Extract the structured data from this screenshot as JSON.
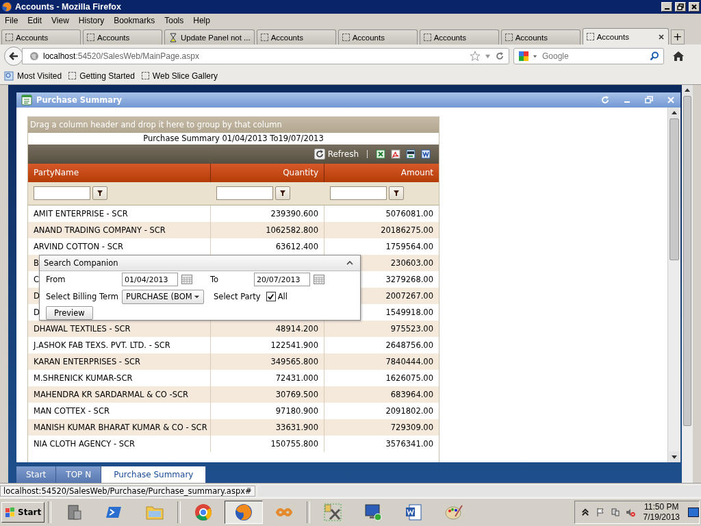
{
  "window": {
    "title": "Accounts - Mozilla Firefox"
  },
  "menu": [
    "File",
    "Edit",
    "View",
    "History",
    "Bookmarks",
    "Tools",
    "Help"
  ],
  "browser_tabs": [
    {
      "label": "Accounts",
      "kind": "page",
      "selected": false
    },
    {
      "label": "Accounts",
      "kind": "page",
      "selected": false
    },
    {
      "label": "Update Panel not ...",
      "kind": "loading",
      "selected": false
    },
    {
      "label": "Accounts",
      "kind": "page",
      "selected": false
    },
    {
      "label": "Accounts",
      "kind": "page",
      "selected": false
    },
    {
      "label": "Accounts",
      "kind": "page",
      "selected": false
    },
    {
      "label": "Accounts",
      "kind": "page",
      "selected": false
    },
    {
      "label": "Accounts",
      "kind": "page",
      "selected": true
    }
  ],
  "new_tab": "+",
  "address_bar": {
    "host": "localhost",
    "path": ":54520/SalesWeb/MainPage.aspx"
  },
  "search": {
    "placeholder": "Google"
  },
  "bookmarks": [
    {
      "label": "Most Visited",
      "kind": "folder"
    },
    {
      "label": "Getting Started",
      "kind": "page"
    },
    {
      "label": "Web Slice Gallery",
      "kind": "page"
    }
  ],
  "app_window": {
    "title": "Purchase Summary"
  },
  "grid": {
    "group_hint": "Drag a column header and drop it here to group by that column",
    "caption": "Purchase Summary 01/04/2013 To19/07/2013",
    "refresh": "Refresh",
    "columns": [
      "PartyName",
      "Quantity",
      "Amount"
    ],
    "rows": [
      {
        "party_name": "AMIT ENTERPRISE - SCR",
        "quantity": "239390.600",
        "amount": "5076081.00"
      },
      {
        "party_name": "ANAND TRADING COMPANY - SCR",
        "quantity": "1062582.800",
        "amount": "20186275.00"
      },
      {
        "party_name": "ARVIND COTTON - SCR",
        "quantity": "63612.400",
        "amount": "1759564.00"
      },
      {
        "party_name": "B",
        "amount": "230603.00"
      },
      {
        "party_name": "C",
        "amount": "3279268.00"
      },
      {
        "party_name": "D",
        "amount": "2007267.00"
      },
      {
        "party_name": "D",
        "amount": "1549918.00"
      },
      {
        "party_name": "DHAWAL TEXTILES - SCR",
        "quantity": "48914.200",
        "amount": "975523.00"
      },
      {
        "party_name": "J.ASHOK FAB TEXS. PVT. LTD. - SCR",
        "quantity": "122541.900",
        "amount": "2648756.00"
      },
      {
        "party_name": "KARAN ENTERPRISES - SCR",
        "quantity": "349565.800",
        "amount": "7840444.00"
      },
      {
        "party_name": "M.SHRENICK KUMAR-SCR",
        "quantity": "72431.000",
        "amount": "1626075.00"
      },
      {
        "party_name": "MAHENDRA KR SARDARMAL & CO -SCR",
        "quantity": "30769.500",
        "amount": "683964.00"
      },
      {
        "party_name": "MAN COTTEX - SCR",
        "quantity": "97180.900",
        "amount": "2091802.00"
      },
      {
        "party_name": "MANISH KUMAR BHARAT KUMAR & CO - SCR",
        "quantity": "33631.900",
        "amount": "729309.00"
      },
      {
        "party_name": "NIA CLOTH AGENCY - SCR",
        "quantity": "150755.800",
        "amount": "3576341.00"
      }
    ]
  },
  "search_companion": {
    "title": "Search Companion",
    "from_label": "From",
    "from": "01/04/2013",
    "to_label": "To",
    "to": "20/07/2013",
    "billing_label": "Select Billing Term",
    "billing": "PURCHASE (BOM",
    "party_label": "Select Party",
    "all_label": "All",
    "all_checked": true,
    "preview": "Preview"
  },
  "app_tabs": [
    {
      "label": "Start",
      "selected": false
    },
    {
      "label": "TOP N",
      "selected": false
    },
    {
      "label": "Purchase Summary",
      "selected": true
    }
  ],
  "status_bar": {
    "url": "localhost:54520/SalesWeb/Purchase/Purchase_summary.aspx#"
  },
  "taskbar": {
    "start": "Start",
    "time": "11:50 PM",
    "date": "7/19/2013"
  }
}
